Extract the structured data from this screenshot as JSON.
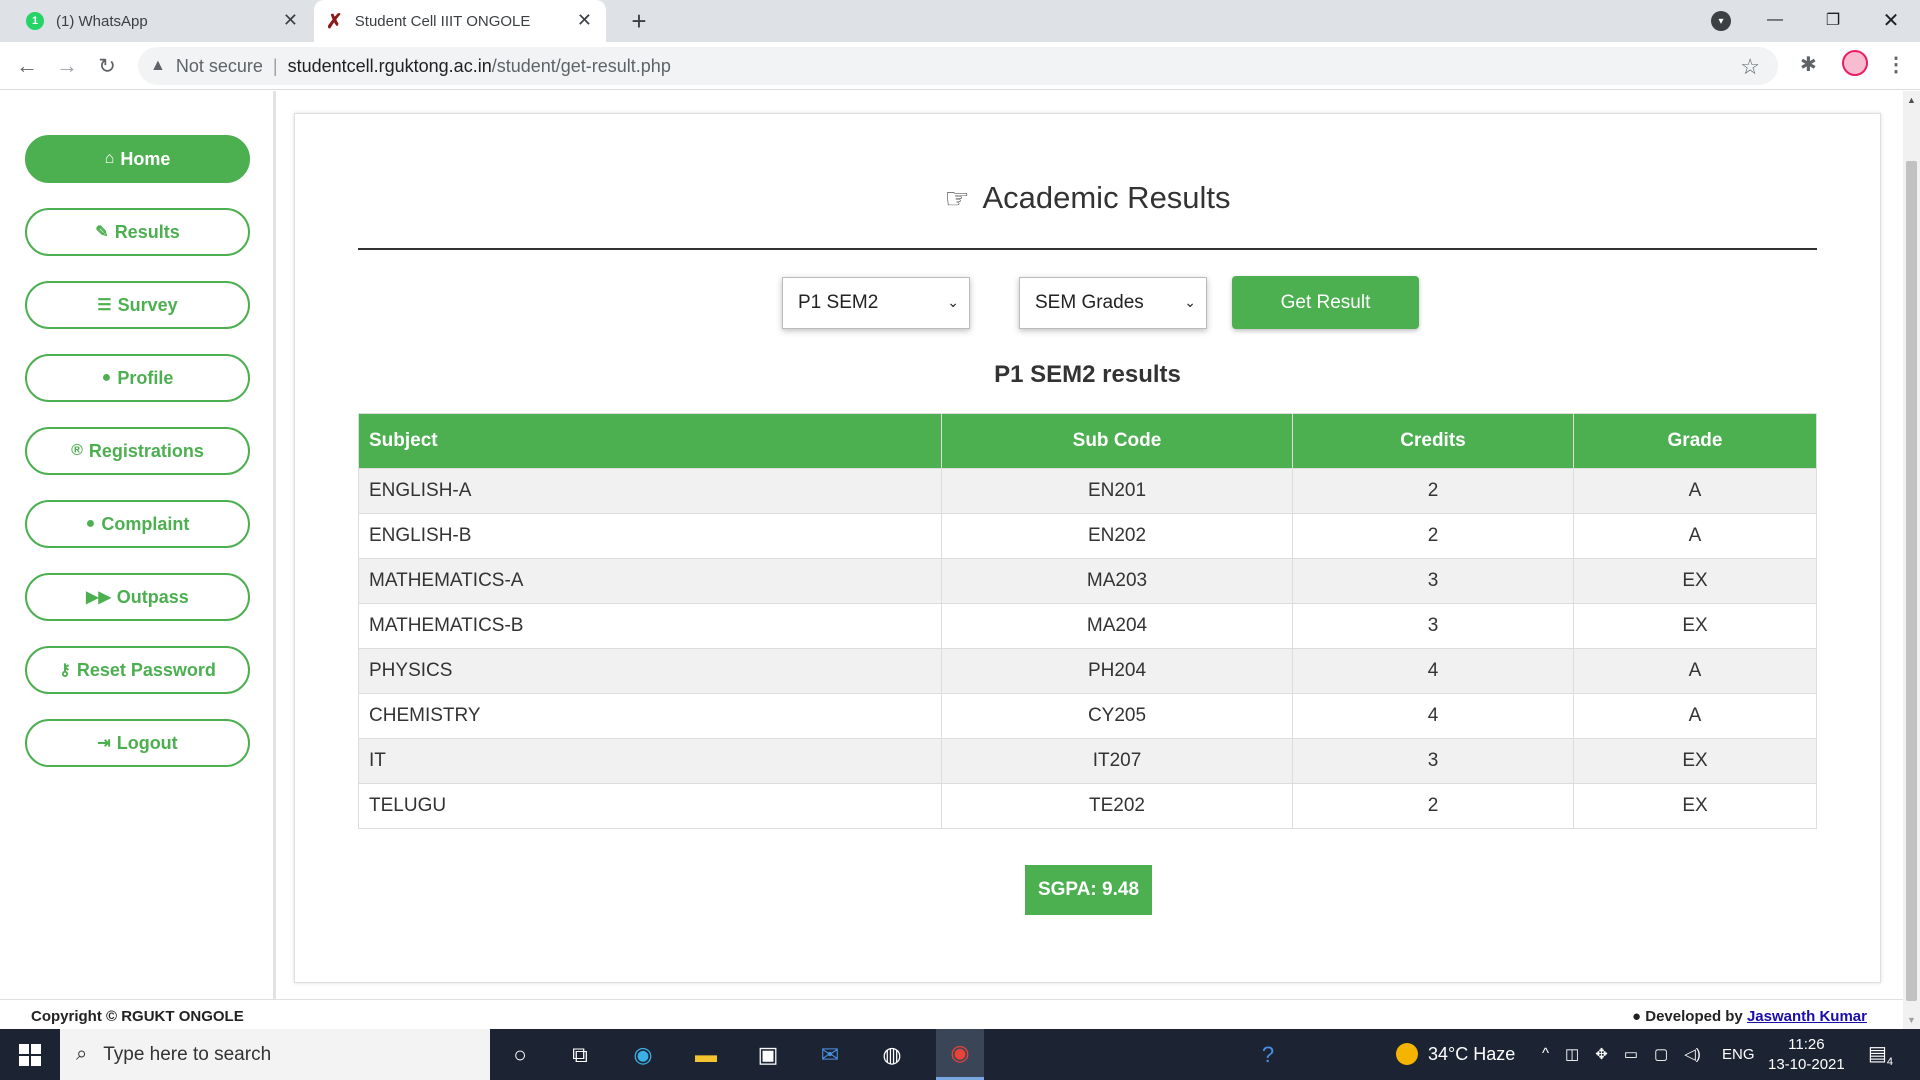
{
  "browser": {
    "tabs": [
      {
        "title": "(1) WhatsApp",
        "badge": "1"
      },
      {
        "title": "Student Cell IIIT ONGOLE"
      }
    ],
    "security_label": "Not secure",
    "url_host": "studentcell.rguktong.ac.in",
    "url_path": "/student/get-result.php"
  },
  "sidebar": {
    "items": [
      {
        "label": "Home",
        "icon": "home-icon"
      },
      {
        "label": "Results",
        "icon": "edit-icon"
      },
      {
        "label": "Survey",
        "icon": "list-icon"
      },
      {
        "label": "Profile",
        "icon": "user-icon"
      },
      {
        "label": "Registrations",
        "icon": "registered-icon"
      },
      {
        "label": "Complaint",
        "icon": "comment-icon"
      },
      {
        "label": "Outpass",
        "icon": "forward-icon"
      },
      {
        "label": "Reset Password",
        "icon": "key-icon"
      },
      {
        "label": "Logout",
        "icon": "sign-out-icon"
      }
    ]
  },
  "main": {
    "heading": "Academic Results",
    "semester_select": "P1 SEM2",
    "type_select": "SEM Grades",
    "get_result_label": "Get Result",
    "result_title": "P1 SEM2 results",
    "table": {
      "headers": [
        "Subject",
        "Sub Code",
        "Credits",
        "Grade"
      ],
      "rows": [
        [
          "ENGLISH-A",
          "EN201",
          "2",
          "A"
        ],
        [
          "ENGLISH-B",
          "EN202",
          "2",
          "A"
        ],
        [
          "MATHEMATICS-A",
          "MA203",
          "3",
          "EX"
        ],
        [
          "MATHEMATICS-B",
          "MA204",
          "3",
          "EX"
        ],
        [
          "PHYSICS",
          "PH204",
          "4",
          "A"
        ],
        [
          "CHEMISTRY",
          "CY205",
          "4",
          "A"
        ],
        [
          "IT",
          "IT207",
          "3",
          "EX"
        ],
        [
          "TELUGU",
          "TE202",
          "2",
          "EX"
        ]
      ]
    },
    "sgpa": "SGPA: 9.48"
  },
  "footer": {
    "copyright": "Copyright © RGUKT ONGOLE",
    "developed_by": "Developed by",
    "developer": "Jaswanth Kumar"
  },
  "taskbar": {
    "search_placeholder": "Type here to search",
    "weather": "34°C  Haze",
    "language": "ENG",
    "time": "11:26",
    "date": "13-10-2021",
    "notification_count": "4"
  },
  "colors": {
    "accent": "#4caf50",
    "taskbar": "#1c2433"
  }
}
